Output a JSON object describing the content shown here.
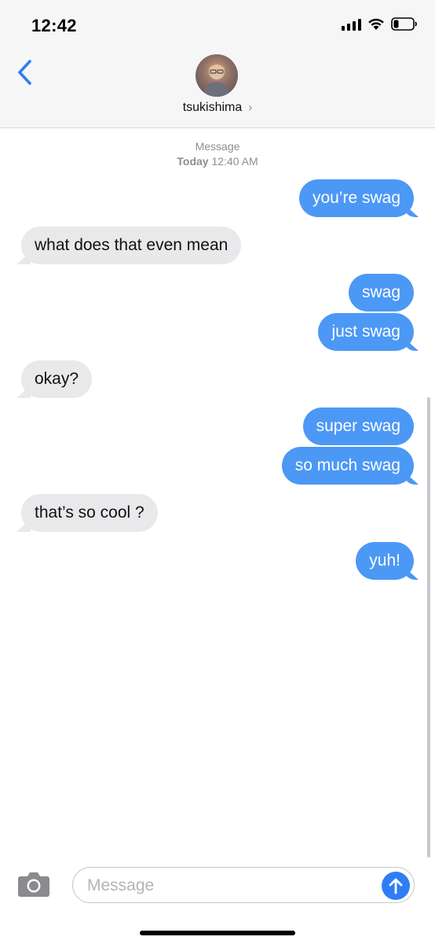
{
  "status_bar": {
    "time": "12:42"
  },
  "header": {
    "contact_name": "tsukishima",
    "chevron": "›"
  },
  "conversation": {
    "service": "Message",
    "date_bold": "Today",
    "time": "12:40 AM",
    "messages": [
      {
        "from": "me",
        "text": "you’re swag"
      },
      {
        "from": "them",
        "text": "what does that even mean"
      },
      {
        "from": "me",
        "text": "swag"
      },
      {
        "from": "me",
        "text": "just swag"
      },
      {
        "from": "them",
        "text": "okay?"
      },
      {
        "from": "me",
        "text": "super swag"
      },
      {
        "from": "me",
        "text": "so much swag"
      },
      {
        "from": "them",
        "text": "that’s so cool ?"
      },
      {
        "from": "me",
        "text": "yuh!"
      }
    ]
  },
  "composer": {
    "placeholder": "Message",
    "value": ""
  },
  "icons": {
    "back": "chevron-left-icon",
    "camera": "camera-icon",
    "send": "arrow-up-icon",
    "signal": "cellular-signal-icon",
    "wifi": "wifi-icon",
    "battery": "battery-icon"
  },
  "colors": {
    "sent_bubble": "#4c98f5",
    "received_bubble": "#e9e9eb",
    "accent": "#2f7ef6",
    "header_bg": "#f6f6f7"
  }
}
